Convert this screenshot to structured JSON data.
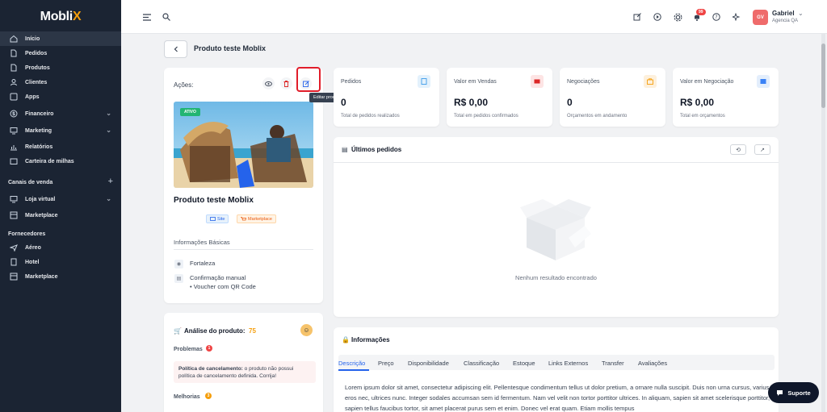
{
  "app": {
    "logo": "Mobli",
    "logo_x": "X"
  },
  "sidebar": {
    "items": [
      {
        "label": "Início",
        "icon": "home-icon"
      },
      {
        "label": "Pedidos",
        "icon": "file-icon"
      },
      {
        "label": "Produtos",
        "icon": "file-icon"
      },
      {
        "label": "Clientes",
        "icon": "user-icon"
      },
      {
        "label": "Apps",
        "icon": "grid-icon"
      },
      {
        "label": "Financeiro",
        "icon": "dollar-icon"
      },
      {
        "label": "Marketing",
        "icon": "monitor-icon"
      },
      {
        "label": "Relatórios",
        "icon": "chart-icon"
      },
      {
        "label": "Carteira de milhas",
        "icon": "wallet-icon"
      }
    ],
    "section_sales": "Canais de venda",
    "sales_items": [
      {
        "label": "Loja virtual",
        "icon": "store-icon"
      },
      {
        "label": "Marketplace",
        "icon": "store-icon"
      }
    ],
    "section_suppliers": "Fornecedores",
    "supplier_items": [
      {
        "label": "Aéreo",
        "icon": "plane-icon"
      },
      {
        "label": "Hotel",
        "icon": "hotel-icon"
      },
      {
        "label": "Marketplace",
        "icon": "store-icon"
      }
    ]
  },
  "topbar": {
    "notification_count": "99",
    "user_initials": "GV",
    "user_name": "Gabriel",
    "user_company": "Agencia QA"
  },
  "page": {
    "title": "Produto teste Moblix"
  },
  "product": {
    "actions_label": "Ações:",
    "tooltip": "Editar produto",
    "status": "ATIVO",
    "name": "Produto teste Moblix",
    "chip_site": "Site",
    "chip_marketplace": "Marketplace",
    "basic_info_label": "Informações Básicas",
    "location": "Fortaleza",
    "confirmation": "Confirmação manual",
    "voucher": "• Voucher com QR Code"
  },
  "analysis": {
    "title": "Análise do produto:",
    "score": "75",
    "problems_label": "Problemas",
    "problems_count": "1",
    "problem_title": "Política de cancelamento:",
    "problem_text": " o produto não possui política de cancelamento definida. Corrija!",
    "improvements_label": "Melhorias",
    "improvements_count": "3"
  },
  "stats": [
    {
      "label": "Pedidos",
      "value": "0",
      "sub": "Total de pedidos realizados",
      "color": "#3b9be8",
      "bg": "#e3f1fc"
    },
    {
      "label": "Valor em Vendas",
      "value": "R$ 0,00",
      "sub": "Total em pedidos confirmados",
      "color": "#dc2626",
      "bg": "#fde4e4"
    },
    {
      "label": "Negociações",
      "value": "0",
      "sub": "Orçamentos em andamento",
      "color": "#f59e0b",
      "bg": "#fdf0dc"
    },
    {
      "label": "Valor em Negociação",
      "value": "R$ 0,00",
      "sub": "Total em orçamentos",
      "color": "#3b82f6",
      "bg": "#e3eefc"
    }
  ],
  "orders": {
    "title": "Últimos pedidos",
    "empty": "Nenhum resultado encontrado"
  },
  "info": {
    "title": "Informações",
    "tabs": [
      "Descrição",
      "Preço",
      "Disponibilidade",
      "Classificação",
      "Estoque",
      "Links Externos",
      "Transfer",
      "Avaliações"
    ],
    "text": "Lorem ipsum dolor sit amet, consectetur adipiscing elit. Pellentesque condimentum tellus ut dolor pretium, a ornare nulla suscipit. Duis non urna cursus, varius eros nec, ultrices nunc. Integer sodales accumsan sem id fermentum. Nam vel velit non tortor porttitor ultrices. In aliquam, sapien sit amet scelerisque porttitor, sapien tellus faucibus tortor, sit amet placerat purus sem et enim. Donec vel erat quam. Etiam mollis tempus"
  },
  "support": {
    "label": "Suporte"
  }
}
